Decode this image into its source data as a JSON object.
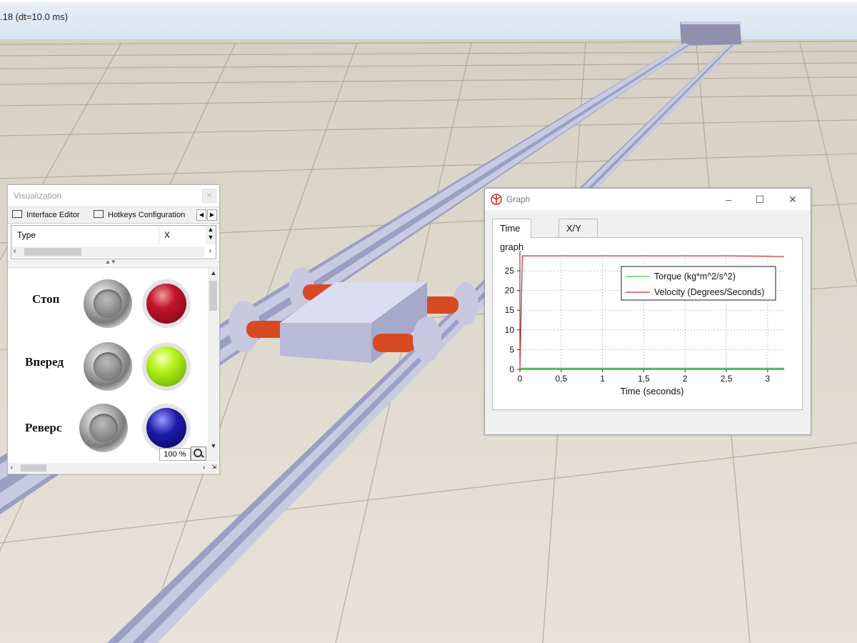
{
  "sim_status": ".18 (dt=10.0 ms)",
  "visualization": {
    "title": "Visualization",
    "close_icon": "close-icon",
    "tabs": [
      {
        "label": "Interface Editor",
        "icon": "interface-editor-icon"
      },
      {
        "label": "Hotkeys Configuration",
        "icon": "hotkeys-icon"
      }
    ],
    "grid": {
      "col_type": "Type",
      "col_x": "X"
    },
    "buttons": [
      {
        "label": "Стоп",
        "lamp_color": "red"
      },
      {
        "label": "Вперед",
        "lamp_color": "green"
      },
      {
        "label": "Реверс",
        "lamp_color": "blue"
      }
    ],
    "zoom": "100 %"
  },
  "graph_window": {
    "title": "Graph",
    "controls": {
      "minimize": "–",
      "maximize": "☐",
      "close": "✕"
    },
    "tabs": [
      {
        "label": "Time graph",
        "active": true
      },
      {
        "label": "X/Y graph",
        "active": false
      }
    ]
  },
  "chart_data": {
    "type": "line",
    "xlabel": "Time (seconds)",
    "ylabel": "",
    "xlim": [
      0,
      3.2
    ],
    "ylim": [
      0,
      29
    ],
    "x_ticks": [
      0,
      0.5,
      1,
      1.5,
      2,
      2.5,
      3
    ],
    "x_tick_labels": [
      "0",
      "0,5",
      "1",
      "1,5",
      "2",
      "2,5",
      "3"
    ],
    "y_ticks": [
      0,
      5,
      10,
      15,
      20,
      25
    ],
    "y_tick_labels": [
      "0",
      "5",
      "10",
      "15",
      "20",
      "25"
    ],
    "grid": true,
    "legend_position": "top-right",
    "series": [
      {
        "name": "Torque (kg*m^2/s^2)",
        "color": "#2ecc40",
        "x": [
          0,
          0.02,
          0.5,
          1,
          1.5,
          2,
          2.5,
          3,
          3.2
        ],
        "y": [
          0,
          0.3,
          0.3,
          0.3,
          0.3,
          0.3,
          0.3,
          0.3,
          0.3
        ]
      },
      {
        "name": "Velocity (Degrees/Seconds)",
        "color": "#d9261c",
        "x": [
          0,
          0.01,
          0.03,
          0.5,
          1,
          1.5,
          2,
          2.5,
          3,
          3.2
        ],
        "y": [
          0,
          10,
          28.8,
          28.8,
          28.8,
          28.8,
          28.8,
          28.8,
          28.7,
          28.6
        ]
      }
    ]
  }
}
